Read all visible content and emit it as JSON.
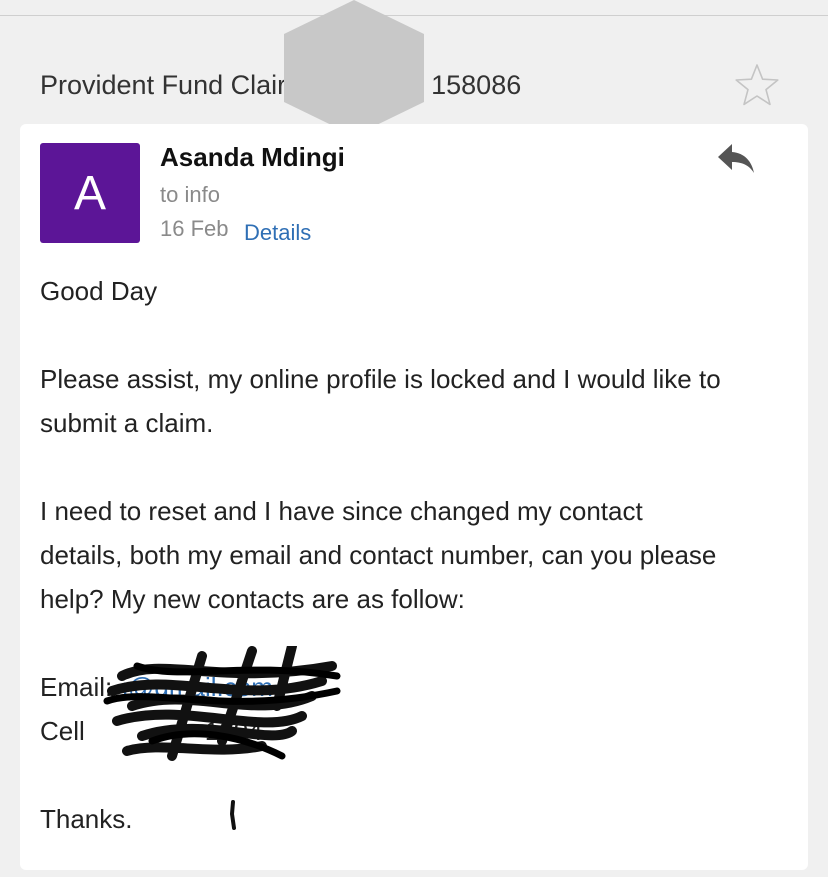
{
  "subject": {
    "text_start": "Provident Fund Clair",
    "text_end": "158086"
  },
  "message": {
    "sender_initial": "A",
    "sender_name": "Asanda Mdingi",
    "recipient": "to info",
    "date": "16 Feb",
    "details_label": "Details",
    "body": {
      "greeting": "Good Day",
      "para1_line1": "Please assist, my online profile is locked and I would like to",
      "para1_line2": "submit a claim.",
      "para2_line1": "I need to reset and I have since changed my contact",
      "para2_line2": "details, both my email and contact number, can you please",
      "para2_line3": "help? My new contacts are as follow:",
      "email_label": "Email:",
      "email_visible": "i@gmail.com",
      "cell_label": "Cell",
      "cell_visible": "1994",
      "closing": "Thanks."
    }
  },
  "colors": {
    "avatar_bg": "#5c1597",
    "link": "#2f6fb5",
    "background": "#f0f0f0",
    "redaction_hexagon": "#c8c8c8"
  },
  "icons": {
    "star": "star-outline-icon",
    "reply": "reply-arrow-icon"
  }
}
